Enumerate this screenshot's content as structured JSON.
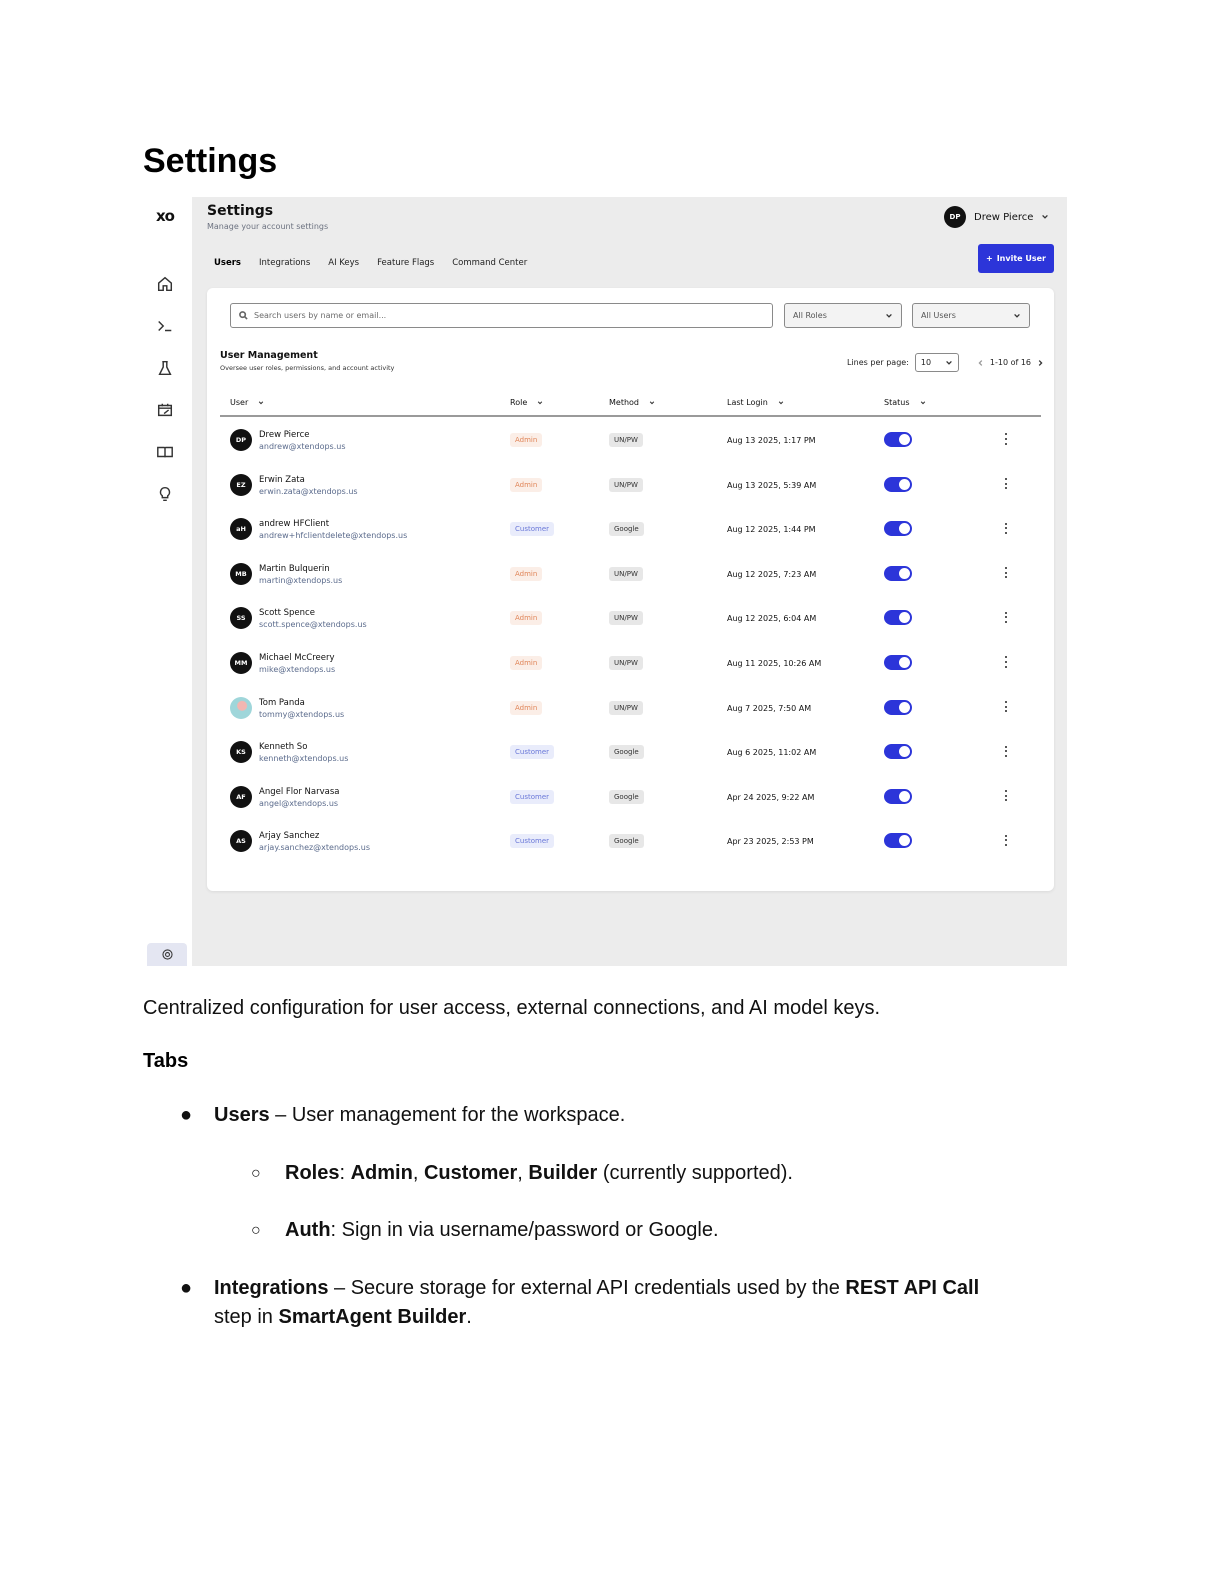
{
  "doc": {
    "title": "Settings",
    "description": "Centralized configuration for user access, external connections, and AI model keys.",
    "tabs_heading": "Tabs",
    "bullets": [
      {
        "term": "Users",
        "text": " – User management for the workspace."
      },
      {
        "term": "Integrations",
        "text": " – Secure storage for external API credentials used by the ",
        "term2": "REST API Call",
        "line2_prefix": "step in ",
        "term3": "SmartAgent Builder",
        "line2_suffix": "."
      }
    ],
    "sub_roles": {
      "term": "Roles",
      "sep": ": ",
      "r1": "Admin",
      "r2": "Customer",
      "r3": "Builder",
      "tail": " (currently supported)."
    },
    "sub_auth": {
      "term": "Auth",
      "text": ": Sign in via username/password or Google."
    }
  },
  "app": {
    "logo": "xo",
    "title": "Settings",
    "subtitle": "Manage your account settings",
    "user": {
      "initials": "DP",
      "name": "Drew Pierce"
    },
    "tabs": [
      "Users",
      "Integrations",
      "AI Keys",
      "Feature Flags",
      "Command Center"
    ],
    "invite_label": "Invite User",
    "search_placeholder": "Search users by name or email...",
    "roles_filter": "All Roles",
    "users_filter": "All Users",
    "section_title": "User Management",
    "section_subtitle": "Oversee user roles, permissions, and account activity",
    "lines_per_page_label": "Lines per page:",
    "lines_per_page": "10",
    "pagination": "1-10 of 16",
    "columns": [
      "User",
      "Role",
      "Method",
      "Last Login",
      "Status"
    ],
    "rows": [
      {
        "initials": "DP",
        "name": "Drew Pierce",
        "email": "andrew@xtendops.us",
        "role": "Admin",
        "method": "UN/PW",
        "last_login": "Aug 13 2025, 1:17 PM",
        "active": true
      },
      {
        "initials": "EZ",
        "name": "Erwin Zata",
        "email": "erwin.zata@xtendops.us",
        "role": "Admin",
        "method": "UN/PW",
        "last_login": "Aug 13 2025, 5:39 AM",
        "active": true
      },
      {
        "initials": "aH",
        "name": "andrew HFClient",
        "email": "andrew+hfclientdelete@xtendops.us",
        "role": "Customer",
        "method": "Google",
        "last_login": "Aug 12 2025, 1:44 PM",
        "active": true
      },
      {
        "initials": "MB",
        "name": "Martin Bulquerin",
        "email": "martin@xtendops.us",
        "role": "Admin",
        "method": "UN/PW",
        "last_login": "Aug 12 2025, 7:23 AM",
        "active": true
      },
      {
        "initials": "SS",
        "name": "Scott Spence",
        "email": "scott.spence@xtendops.us",
        "role": "Admin",
        "method": "UN/PW",
        "last_login": "Aug 12 2025, 6:04 AM",
        "active": true
      },
      {
        "initials": "MM",
        "name": "Michael McCreery",
        "email": "mike@xtendops.us",
        "role": "Admin",
        "method": "UN/PW",
        "last_login": "Aug 11 2025, 10:26 AM",
        "active": true
      },
      {
        "initials": "",
        "name": "Tom Panda",
        "email": "tommy@xtendops.us",
        "role": "Admin",
        "method": "UN/PW",
        "last_login": "Aug 7 2025, 7:50 AM",
        "active": true
      },
      {
        "initials": "KS",
        "name": "Kenneth So",
        "email": "kenneth@xtendops.us",
        "role": "Customer",
        "method": "Google",
        "last_login": "Aug 6 2025, 11:02 AM",
        "active": true
      },
      {
        "initials": "AF",
        "name": "Angel Flor Narvasa",
        "email": "angel@xtendops.us",
        "role": "Customer",
        "method": "Google",
        "last_login": "Apr 24 2025, 9:22 AM",
        "active": true
      },
      {
        "initials": "AS",
        "name": "Arjay Sanchez",
        "email": "arjay.sanchez@xtendops.us",
        "role": "Customer",
        "method": "Google",
        "last_login": "Apr 23 2025, 2:53 PM",
        "active": true
      }
    ],
    "colors": {
      "accent": "#2c35d9",
      "admin_badge": "#e0865a",
      "customer_badge": "#6a78d8"
    },
    "rail_icons": [
      "home-icon",
      "terminal-icon",
      "flask-icon",
      "calendar-edit-icon",
      "book-icon",
      "lightbulb-icon",
      "gear-icon"
    ]
  }
}
